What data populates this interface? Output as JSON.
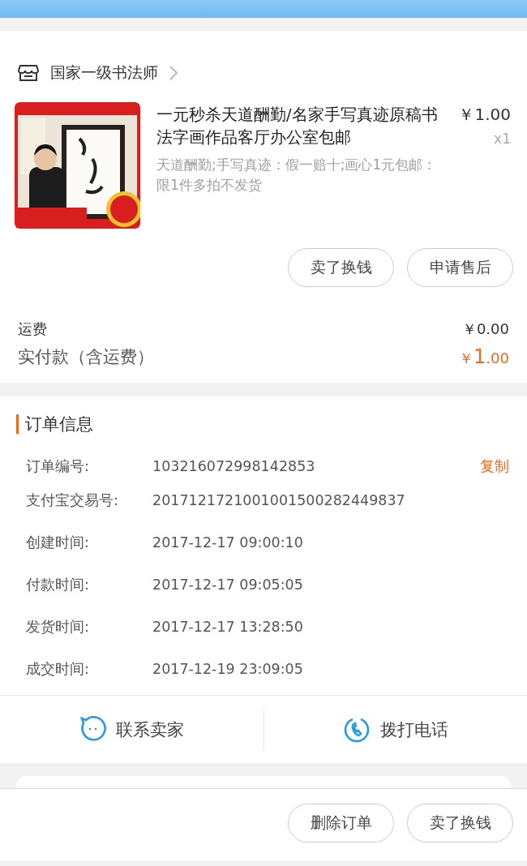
{
  "shop": {
    "name": "国家一级书法师"
  },
  "product": {
    "kind": "picture",
    "title": "一元秒杀天道酬勤/名家手写真迹原稿书法字画作品客厅办公室包邮",
    "description": "天道酬勤;手写真迹：假一赔十;画心1元包邮：限1件多拍不发货",
    "price": "￥1.00",
    "quantity": "x1"
  },
  "item_actions": [
    "卖了换钱",
    "申请售后"
  ],
  "fees": [
    {
      "label": "运费",
      "value": "￥0.00",
      "kind": "plain"
    },
    {
      "label": "实付款（含运费）",
      "value": "￥1.00",
      "kind": "total"
    }
  ],
  "order_info": {
    "title": "订单信息",
    "copy": "复制",
    "rows": [
      {
        "label": "订单编号:",
        "value": "103216072998142853"
      },
      {
        "label": "支付宝交易号:",
        "value": "2017121721001001500282449837"
      },
      {
        "label": "创建时间:",
        "value": "2017-12-17 09:00:10"
      },
      {
        "label": "付款时间:",
        "value": "2017-12-17 09:05:05"
      },
      {
        "label": "发货时间:",
        "value": "2017-12-17 13:28:50"
      },
      {
        "label": "成交时间:",
        "value": "2017-12-19 23:09:05"
      }
    ]
  },
  "contact": [
    {
      "kind": "chat",
      "label": "联系卖家"
    },
    {
      "kind": "phone",
      "label": "拨打电话"
    }
  ],
  "bottom_actions": [
    "删除订单",
    "卖了换钱"
  ]
}
